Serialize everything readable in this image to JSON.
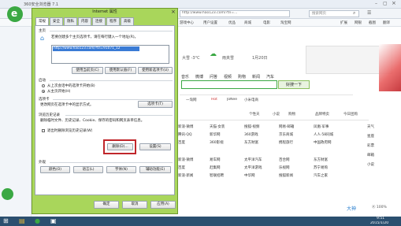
{
  "browser": {
    "title": "360安全浏览器 7.1",
    "address": "http://www.hao123.com/?tn=...",
    "search_hint": "搜索网页",
    "favorites": [
      "收藏",
      "手机收藏夹",
      "谷歌",
      "网址大全",
      "360搜索",
      "游戏中心",
      "用户设置",
      "优品",
      "商城",
      "电影",
      "淘宝网"
    ],
    "right_menu": [
      "扩展",
      "网银",
      "截图",
      "翻译"
    ]
  },
  "page": {
    "weather_a": "大雪 -3°C",
    "weather_b": "雨夹雪",
    "date": "1月20日",
    "search_button": "好搜一下",
    "nav_tabs": [
      "网页",
      "音乐",
      "微博",
      "问答",
      "视频",
      "购物",
      "新闻",
      "汽车"
    ],
    "promo": [
      "一淘网",
      "Hot",
      "JoNee",
      "小米电商"
    ],
    "banners": [
      "个性天",
      "小说",
      "购物",
      "品牌特卖",
      "今日团购"
    ],
    "links": [
      [
        "新浪·微博",
        "天猫·女装",
        "搜狐·视频",
        "网易·邮箱",
        "凤凰·军事"
      ],
      [
        "腾讯·QQ",
        "新华网",
        "360游戏",
        "京东商城",
        "人人·58同城"
      ],
      [
        "百度",
        "360影视",
        "东方财富",
        "携程旅行",
        "中国政府网"
      ],
      [
        "新浪·微博",
        "易车网",
        "太平洋汽车",
        "百合网",
        "东方财富"
      ],
      [
        "百度",
        "赶集网",
        "太平洋游戏",
        "乐视网",
        "苏宁易购"
      ],
      [
        "新浪·新闻",
        "智联招聘",
        "中华网",
        "搜狐新闻",
        "汽车之家"
      ]
    ],
    "side_labels": [
      "天气",
      "星座",
      "彩票",
      "邮箱",
      "小说"
    ],
    "status": "大神",
    "status_right": "Ⓐ 100%"
  },
  "dialog": {
    "title": "Internet 属性",
    "tabs": [
      "常规",
      "安全",
      "隐私",
      "内容",
      "连接",
      "程序",
      "高级"
    ],
    "home_group": "主页",
    "home_desc": "若要创建多个主页选项卡，请在每行键入一个地址(R)。",
    "home_url": "http://www.hao123.com/?tn=91071_12",
    "home_buttons": [
      "使用当前页(C)",
      "使用默认值(F)",
      "使用新选项卡(U)"
    ],
    "startup_group": "启动",
    "startup_opts": [
      "从上次会话中的选项卡开始(B)",
      "从主页开始(H)"
    ],
    "tabs_group": "选项卡",
    "tabs_desc": "更改网页在选项卡中的显示方式。",
    "tabs_button": "选项卡(T)",
    "history_group": "浏览历史记录",
    "history_desc": "删除临时文件、历史记录、Cookie、保存的密码和网页表单信息。",
    "history_check": "退出时删除浏览历史记录(W)",
    "delete_button": "删除(D)...",
    "settings_button": "设置(S)",
    "appearance_group": "外观",
    "appearance_buttons": [
      "颜色(O)",
      "语言(L)",
      "字体(N)",
      "辅助功能(E)"
    ],
    "footer_buttons": [
      "确定",
      "取消",
      "应用(A)"
    ]
  },
  "taskbar": {
    "time": "9:51",
    "date": "2015/1/20",
    "colors": {
      "dialog_frame": "#a9d65b",
      "highlight": "#c0262b",
      "taskbar": "#2b4f6f"
    }
  }
}
